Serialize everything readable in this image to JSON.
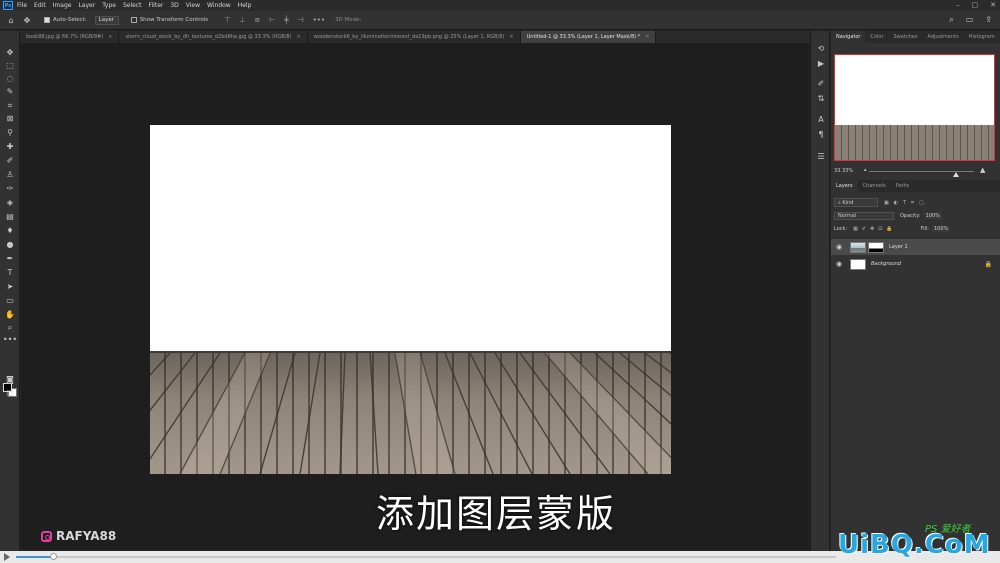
{
  "menu": {
    "logo": "Ps",
    "items": [
      "File",
      "Edit",
      "Image",
      "Layer",
      "Type",
      "Select",
      "Filter",
      "3D",
      "View",
      "Window",
      "Help"
    ],
    "window_controls": [
      "–",
      "▢",
      "✕"
    ]
  },
  "options": {
    "auto_select_label": "Auto-Select:",
    "auto_select_value": "Layer",
    "transform_label": "Show Transform Controls",
    "mode_label": "3D Mode:"
  },
  "tabs": [
    {
      "label": "book88.jpg @ 66.7% (RGB/8#)",
      "active": false
    },
    {
      "label": "storm_cloud_stock_by_dh_textures_d2bd8ha.jpg @ 33.3% (RGB/8)",
      "active": false
    },
    {
      "label": "woodenstock6_by_illuminationinterest_da19pb.png @ 25% (Layer 1, RGB/8)",
      "active": false
    },
    {
      "label": "Untitled-1 @ 33.3% (Layer 1, Layer Mask/8) *",
      "active": true
    }
  ],
  "canvas": {
    "subtitle": "添加图层蒙版",
    "watermark": "RAFYA88"
  },
  "panels": {
    "top_tabs": [
      "Navigator",
      "Color",
      "Swatches",
      "Adjustments",
      "Histogram"
    ],
    "zoom_value": "33.33%",
    "layer_tabs": [
      "Layers",
      "Channels",
      "Paths"
    ],
    "kind_label": "Kind",
    "blend_mode": "Normal",
    "opacity_label": "Opacity:",
    "opacity_value": "100%",
    "lock_label": "Lock:",
    "fill_label": "Fill:",
    "fill_value": "100%",
    "layers": [
      {
        "name": "Layer 1",
        "selected": true
      },
      {
        "name": "Background",
        "selected": false
      }
    ]
  },
  "player": {
    "progress": 0.045,
    "site_logo": "UiBQ.CoM",
    "ps_badge": "PS 爱好者"
  },
  "colors": {
    "accent": "#31a8ff",
    "nav_border": "#dd3333",
    "progress": "#3d8fd6"
  }
}
